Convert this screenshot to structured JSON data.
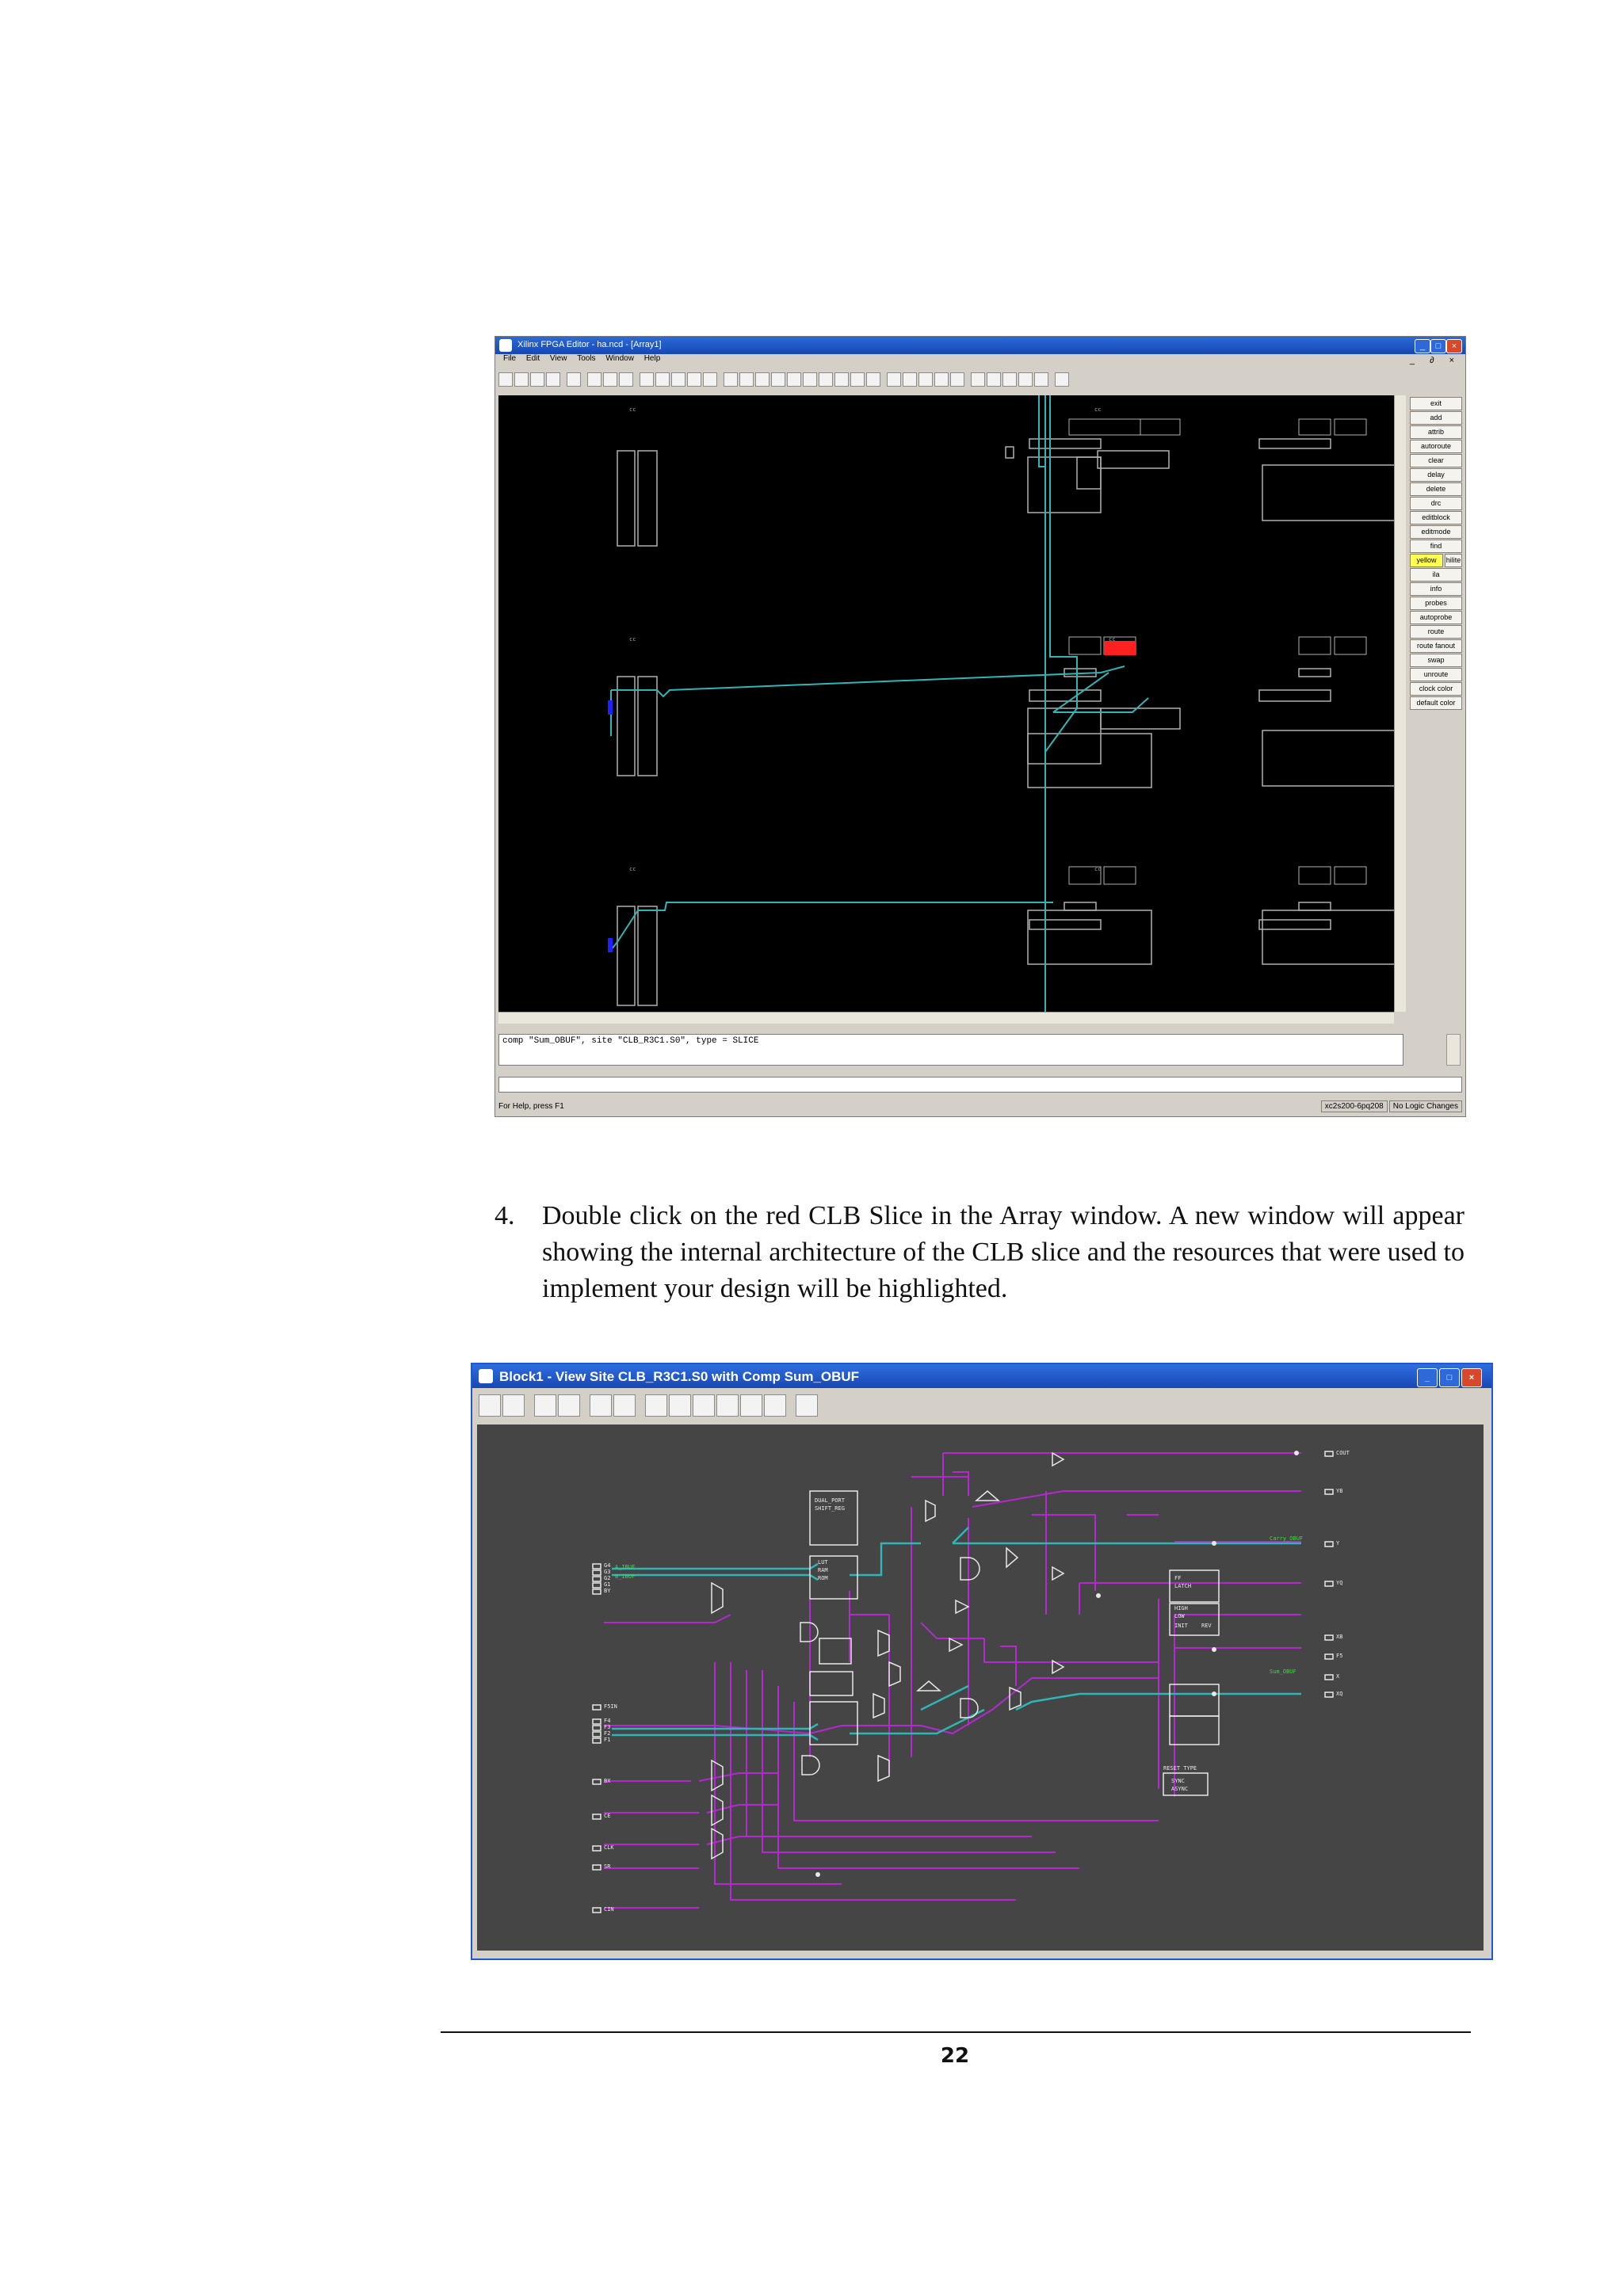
{
  "window1": {
    "title": "Xilinx FPGA Editor - ha.ncd - [Array1]",
    "menu": [
      "File",
      "Edit",
      "View",
      "Tools",
      "Window",
      "Help"
    ],
    "mdi_controls": "_ ∂ ×",
    "side_buttons": [
      "exit",
      "add",
      "attrib",
      "autoroute",
      "clear",
      "delay",
      "delete",
      "drc",
      "editblock",
      "editmode",
      "find",
      "yellow",
      "hilite",
      "ila",
      "info",
      "probes",
      "autoprobe",
      "route",
      "route fanout",
      "swap",
      "unroute",
      "clock color",
      "default color"
    ],
    "console_text": "comp \"Sum_OBUF\",  site \"CLB_R3C1.S0\",  type = SLICE",
    "status_left": "For Help, press F1",
    "status_right": [
      "xc2s200-6pq208",
      "No Logic Changes"
    ]
  },
  "step": {
    "number": "4.",
    "text": "Double click on the red CLB Slice in the Array window.  A new window will appear showing the internal architecture of the CLB slice and the resources that were used to implement your design will be highlighted."
  },
  "window2": {
    "title": "Block1 - View Site CLB_R3C1.S0 with Comp Sum_OBUF",
    "left_pins": [
      "G4",
      "G3",
      "G2",
      "G1",
      "BY",
      "F5IN",
      "F4",
      "F3",
      "F2",
      "F1",
      "BX",
      "CE",
      "CLK",
      "SR",
      "CIN"
    ],
    "right_pins": [
      "COUT",
      "YB",
      "Y",
      "YQ",
      "XB",
      "F5",
      "X",
      "XQ"
    ],
    "green_labels": [
      "A_IBUF",
      "B_IBUF",
      "Carry_OBUF",
      "Sum_OBUF"
    ],
    "misc_labels": [
      "RESET TYPE",
      "SYNC",
      "ASYNC",
      "FF",
      "LATCH",
      "HIGH",
      "LOW",
      "INIT",
      "REV",
      "LUT",
      "RAM",
      "ROM",
      "DUAL_PORT",
      "SHIFT_REG"
    ]
  },
  "page_number": "22",
  "colors": {
    "titlebar_blue": "#1f58cf",
    "canvas1_bg": "#000000",
    "canvas2_bg": "#454545",
    "wire_cyan": "#2fb5b5",
    "wire_magenta": "#b428d0",
    "highlight_red": "#ff2020",
    "net_green": "#33e033"
  }
}
